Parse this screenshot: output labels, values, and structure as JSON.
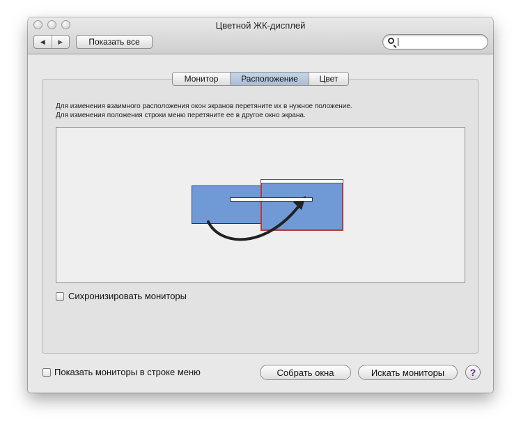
{
  "window": {
    "title": "Цветной ЖК-дисплей"
  },
  "toolbar": {
    "back_icon": "◀",
    "forward_icon": "▶",
    "show_all_label": "Показать все",
    "search_value": "",
    "search_placeholder": ""
  },
  "tabs": [
    {
      "label": "Монитор",
      "active": false
    },
    {
      "label": "Расположение",
      "active": true
    },
    {
      "label": "Цвет",
      "active": false
    }
  ],
  "instructions": {
    "line1": "Для изменения взаимного расположения окон экранов перетяните их в нужное положение.",
    "line2": "Для изменения положения строки меню перетяните ее в другое окно экрана."
  },
  "arrangement": {
    "monitor_color": "#6f9ad6",
    "selected_border_color": "#b63a3a",
    "drag_arrow": "curved-arrow-icon"
  },
  "mirror_checkbox": {
    "label": "Сихронизировать мониторы",
    "checked": false
  },
  "footer": {
    "menu_checkbox_label": "Показать мониторы в строке меню",
    "menu_checkbox_checked": false,
    "gather_label": "Собрать окна",
    "detect_label": "Искать мониторы",
    "help_label": "?"
  }
}
